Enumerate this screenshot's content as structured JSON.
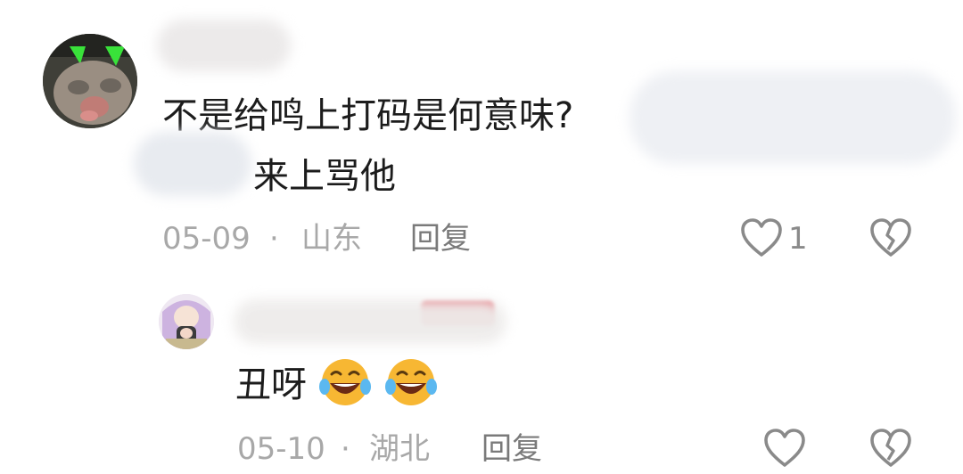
{
  "comment": {
    "text_line1": "不是给鸣上打码是何意味?",
    "text_line2": "来上骂他",
    "date": "05-09",
    "separator": "·",
    "location": "山东",
    "reply_label": "回复",
    "like_count": "1"
  },
  "reply": {
    "text": "丑呀",
    "emojis": [
      "laughing-crying-emoji",
      "laughing-crying-emoji"
    ],
    "date": "05-10",
    "separator": "·",
    "location": "湖北",
    "reply_label": "回复"
  },
  "colors": {
    "text": "#1c1c1c",
    "meta": "#a8a8a8",
    "badge": "#e0434f",
    "emoji_face": "#f7b733"
  }
}
